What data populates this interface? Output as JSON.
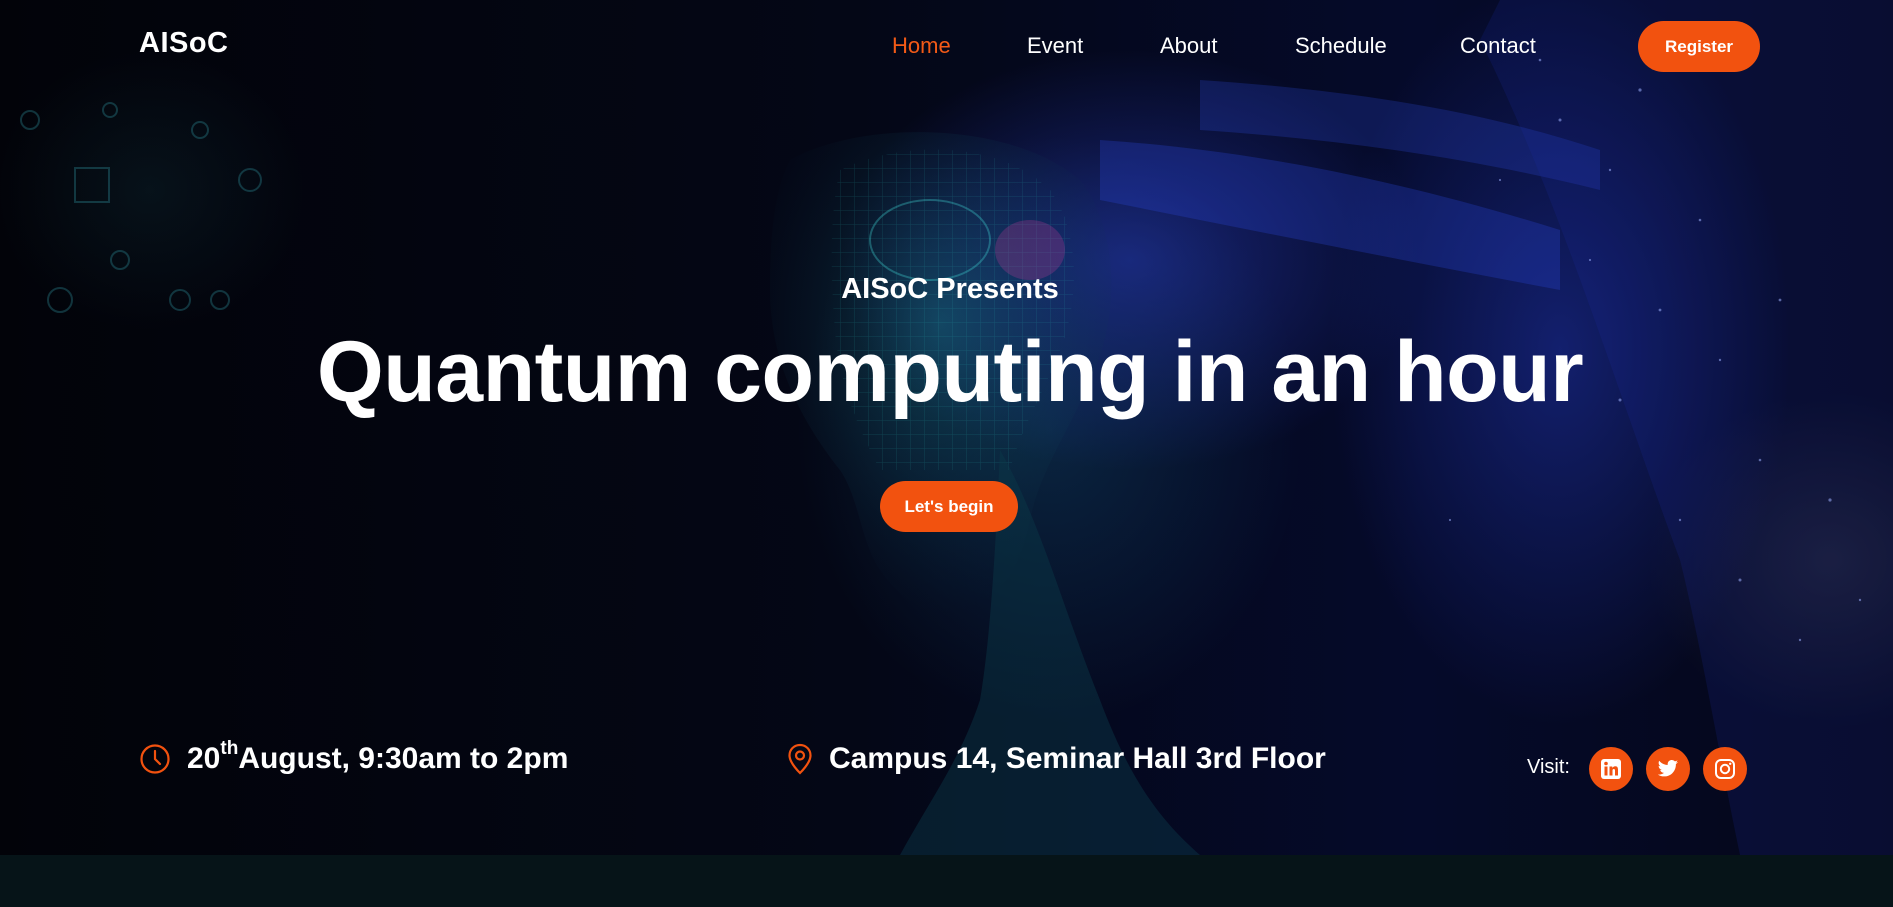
{
  "header": {
    "logo": "AISoC",
    "nav": [
      {
        "label": "Home",
        "active": true
      },
      {
        "label": "Event",
        "active": false
      },
      {
        "label": "About",
        "active": false
      },
      {
        "label": "Schedule",
        "active": false
      },
      {
        "label": "Contact",
        "active": false
      }
    ],
    "register_label": "Register"
  },
  "hero": {
    "kicker": "AISoC Presents",
    "headline": "Quantum computing in an hour",
    "cta_label": "Let's begin"
  },
  "event_info": {
    "date_day": "20",
    "date_suffix": "th",
    "date_rest": "August, 9:30am to 2pm",
    "date_icon": "clock-icon",
    "location": "Campus 14, Seminar Hall 3rd Floor",
    "location_icon": "map-pin-icon"
  },
  "social": {
    "visit_label": "Visit:",
    "links": [
      {
        "icon": "linkedin-icon"
      },
      {
        "icon": "twitter-icon"
      },
      {
        "icon": "instagram-icon"
      }
    ]
  },
  "colors": {
    "accent": "#f2520f",
    "background": "#030510",
    "text": "#ffffff"
  }
}
